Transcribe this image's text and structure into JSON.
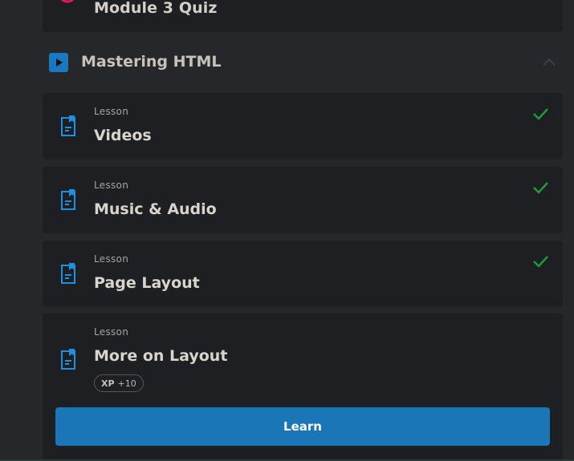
{
  "quiz": {
    "title": "Module 3 Quiz",
    "icon": "quiz-icon"
  },
  "section": {
    "title": "Mastering HTML",
    "icon": "play-icon",
    "expanded": true
  },
  "lessons": [
    {
      "kicker": "Lesson",
      "title": "Videos",
      "completed": true
    },
    {
      "kicker": "Lesson",
      "title": "Music & Audio",
      "completed": true
    },
    {
      "kicker": "Lesson",
      "title": "Page Layout",
      "completed": true
    },
    {
      "kicker": "Lesson",
      "title": "More on Layout",
      "completed": false,
      "xp_label": "XP",
      "xp_value": "+10"
    }
  ],
  "actions": {
    "learn_label": "Learn"
  },
  "colors": {
    "accent": "#1b76b8",
    "check": "#1f9a3a",
    "quiz_accent": "#e2185b"
  }
}
